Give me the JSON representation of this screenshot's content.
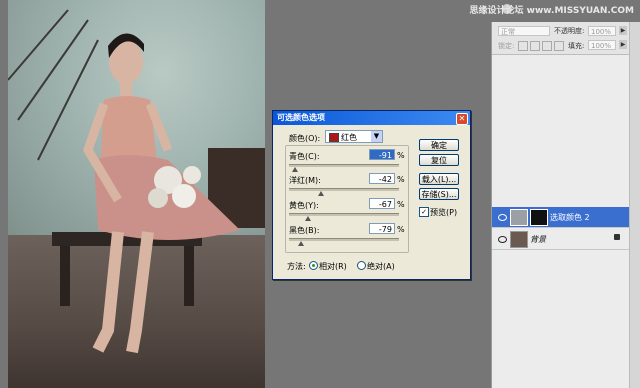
{
  "watermark": "思缘设计论坛 www.MISSYUAN.COM",
  "dialog": {
    "title": "可选颜色选项",
    "close": "✕",
    "color_label": "颜色(O):",
    "color_value": "红色",
    "sliders": [
      {
        "label": "青色(C):",
        "value": "-91",
        "unit": "%",
        "position": 0.05
      },
      {
        "label": "洋红(M):",
        "value": "-42",
        "unit": "%",
        "position": 0.29
      },
      {
        "label": "黄色(Y):",
        "value": "-67",
        "unit": "%",
        "position": 0.17
      },
      {
        "label": "黑色(B):",
        "value": "-79",
        "unit": "%",
        "position": 0.11
      }
    ],
    "buttons": [
      "确定",
      "复位",
      "载入(L)...",
      "存储(S)..."
    ],
    "preview_label": "预览(P)",
    "preview_checked": true,
    "method_label": "方法:",
    "method_relative": "相对(R)",
    "method_absolute": "绝对(A)",
    "method_selected": "relative"
  },
  "panel": {
    "blend_mode": "正常",
    "opacity_label": "不透明度:",
    "opacity_value": "100%",
    "lock_label": "锁定:",
    "fill_label": "填充:",
    "fill_value": "100%",
    "layers": [
      {
        "name": "选取颜色 2",
        "selected": true
      },
      {
        "name": "背景",
        "selected": false
      }
    ]
  },
  "colors": {
    "selection": "#3a6fd0",
    "swatch_red": "#b01818"
  }
}
